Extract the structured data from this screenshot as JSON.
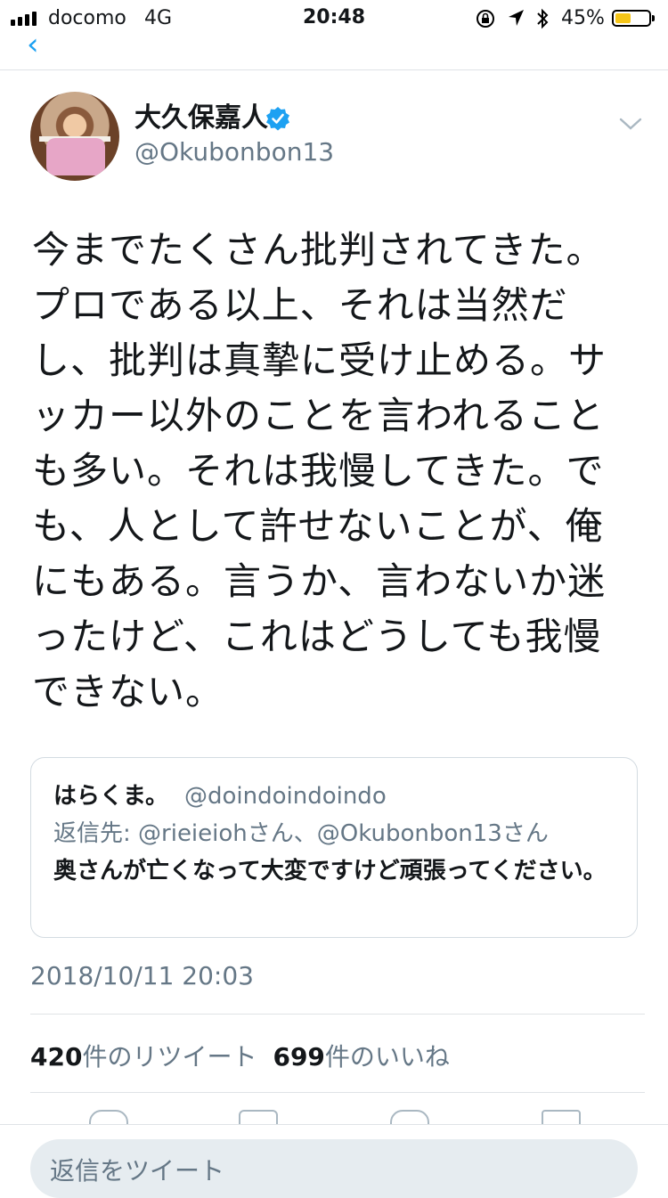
{
  "status_bar": {
    "carrier": "docomo",
    "network": "4G",
    "time": "20:48",
    "battery": "45%",
    "battery_color": "#f5c518"
  },
  "tweet": {
    "author_name": "大久保嘉人",
    "author_handle": "@Okubonbon13",
    "verified_color": "#1da1f2",
    "text_lines": [
      "今までたくさん批判されてきた。",
      "プロである以上、それは当然だ",
      "し、批判は真摯に受け止める。サ",
      "ッカー以外のことを言われること",
      "も多い。それは我慢してきた。で",
      "も、人として許せないことが、俺",
      "にもある。言うか、言わないか迷",
      "ったけど、これはどうしても我慢",
      "できない。"
    ],
    "timestamp": "2018/10/11 20:03",
    "retweet_count": "420",
    "retweet_label": "件のリツイート",
    "like_count": "699",
    "like_label": "件のいいね"
  },
  "quote": {
    "name": "はらくま。",
    "handle": "@doindoindoindo",
    "reply_to": "返信先: @rieieiohさん、@Okubonbon13さん",
    "text": "奥さんが亡くなって大変ですけど頑張ってください。"
  },
  "reply_bar": {
    "placeholder": "返信をツイート"
  },
  "icons": [
    "signal-icon",
    "orientation-lock-icon",
    "location-arrow-icon",
    "bluetooth-icon",
    "battery-icon",
    "verified-badge-icon",
    "chevron-down-icon",
    "reply-icon",
    "retweet-icon",
    "like-icon",
    "share-icon"
  ]
}
